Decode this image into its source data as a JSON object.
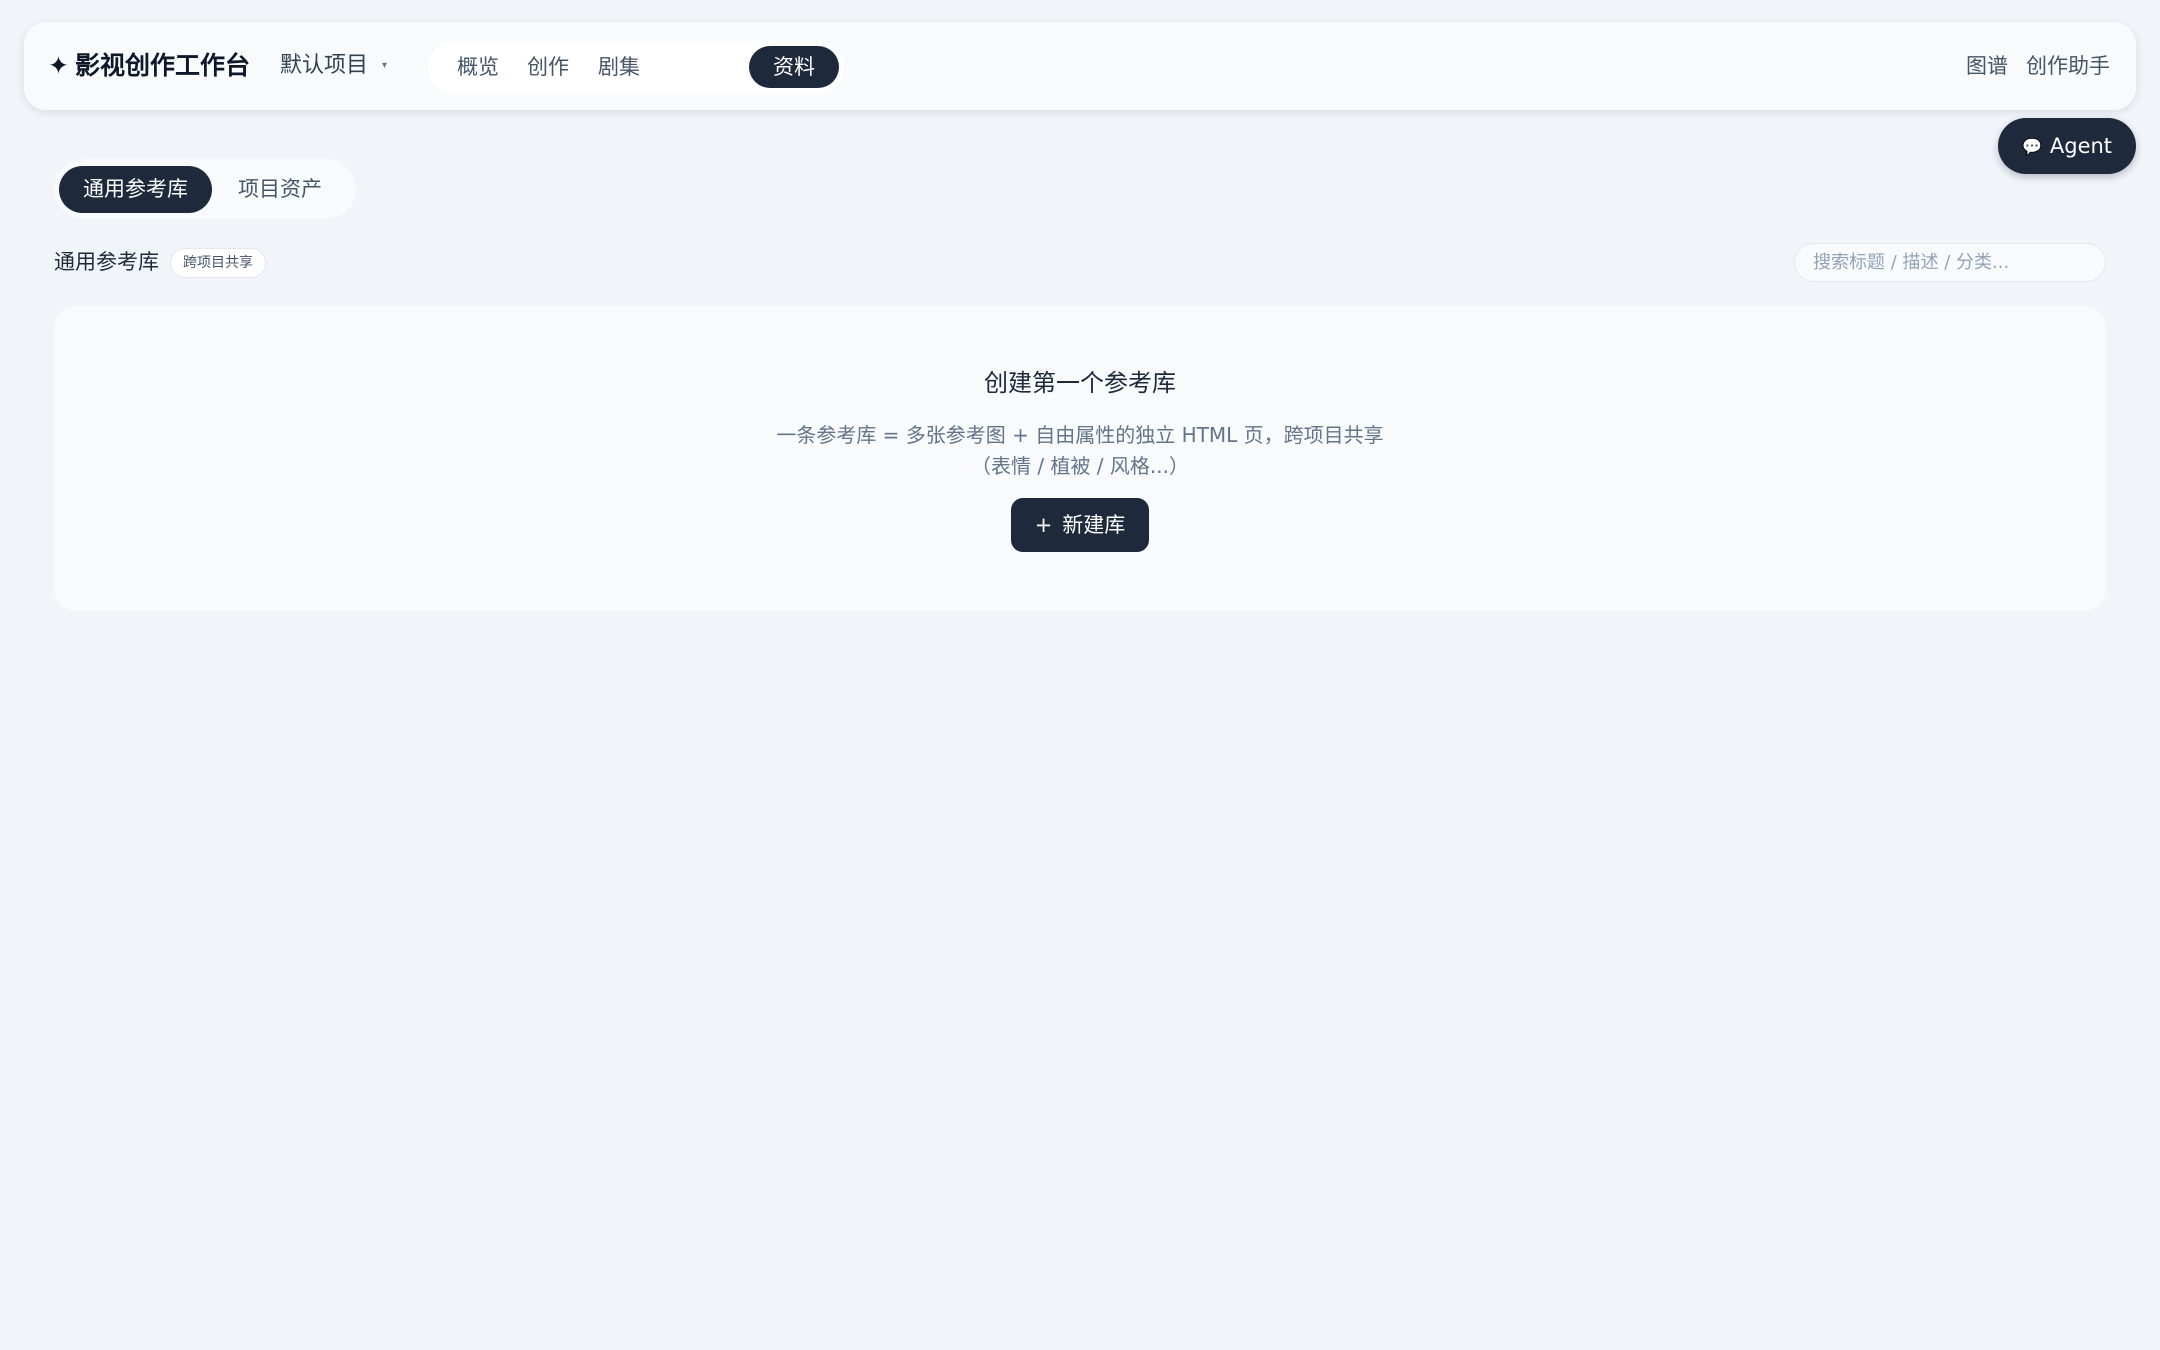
{
  "header": {
    "brand_icon": "✦",
    "brand_title": "影视创作工作台",
    "project_selector": "默认项目",
    "caret_icon": "▾",
    "nav_tabs": [
      {
        "label": "概览",
        "active": false
      },
      {
        "label": "创作",
        "active": false
      },
      {
        "label": "剧集",
        "active": false
      },
      {
        "label": "资料",
        "active": true
      }
    ],
    "right_links": [
      "图谱",
      "创作助手"
    ]
  },
  "agent_button": {
    "icon": "💬",
    "label": "Agent"
  },
  "library_tabs": [
    {
      "label": "通用参考库",
      "active": true
    },
    {
      "label": "项目资产",
      "active": false
    }
  ],
  "section": {
    "title": "通用参考库",
    "badge": "跨项目共享",
    "search_placeholder": "搜索标题 / 描述 / 分类..."
  },
  "empty_state": {
    "title": "创建第一个参考库",
    "description": "一条参考库 = 多张参考图 + 自由属性的独立 HTML 页，跨项目共享（表情 / 植被 / 风格...）",
    "button_icon": "+",
    "button_label": "新建库"
  },
  "colors": {
    "background": "#f1f4f9",
    "accent": "#1e293b",
    "card": "#f8fafc",
    "muted_text": "#64748b"
  }
}
